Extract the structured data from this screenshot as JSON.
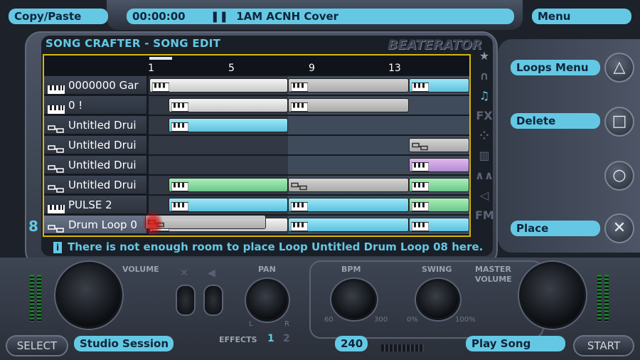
{
  "top_bar": {
    "copy_paste": "Copy/Paste",
    "time": "00:00:00",
    "song_title": "1AM ACNH Cover",
    "menu": "Menu"
  },
  "editor": {
    "title": "SONG CRAFTER - SONG EDIT",
    "logo": "BEATERATOR",
    "ruler": [
      "1",
      "5",
      "9",
      "13"
    ],
    "tracks": [
      {
        "label": "0000000 Gar",
        "icon": "keys-icon"
      },
      {
        "label": "0 !",
        "icon": "keys-icon"
      },
      {
        "label": "Untitled Drui",
        "icon": "drum-icon"
      },
      {
        "label": "Untitled Drui",
        "icon": "drum-icon"
      },
      {
        "label": "Untitled Drui",
        "icon": "drum-icon"
      },
      {
        "label": "Untitled Drui",
        "icon": "drum-icon"
      },
      {
        "label": "PULSE 2",
        "icon": "keys-icon"
      },
      {
        "label": "Drum Loop 0",
        "icon": "drum-icon"
      }
    ],
    "track_number": "8",
    "status_message": "There is not enough room to place Loop Untitled Drum Loop 08 here.",
    "sidebar_icons": [
      "star-icon",
      "headphones-icon",
      "notes-icon",
      "fx-icon",
      "pattern-icon",
      "keyboard-icon",
      "wave-icon",
      "speaker-icon",
      "fm-icon"
    ],
    "sidebar_glyphs": [
      "★",
      "∩",
      "♫",
      "FX",
      "⁘",
      "▥",
      "∧∧",
      "◁",
      "FM"
    ]
  },
  "actions": {
    "loops_menu": "Loops Menu",
    "delete": "Delete",
    "empty": "",
    "place": "Place",
    "triangle": "△",
    "square": "□",
    "circle": "○",
    "cross": "✕"
  },
  "mixer": {
    "volume_label": "VOLUME",
    "pan_label": "PAN",
    "pan_l": "L",
    "pan_r": "R",
    "bpm_label": "BPM",
    "bpm_min": "60",
    "bpm_max": "300",
    "swing_label": "SWING",
    "swing_min": "0%",
    "swing_max": "100%",
    "master_label_1": "MASTER",
    "master_label_2": "VOLUME",
    "effects_label": "EFFECTS",
    "effect_1": "1",
    "effect_2": "2"
  },
  "bottom_bar": {
    "select": "SELECT",
    "studio_session": "Studio Session",
    "bpm_value": "240",
    "play_song": "Play Song",
    "start": "START"
  },
  "colors": {
    "accent": "#64c8e4",
    "selection_border": "#d6b70a"
  }
}
